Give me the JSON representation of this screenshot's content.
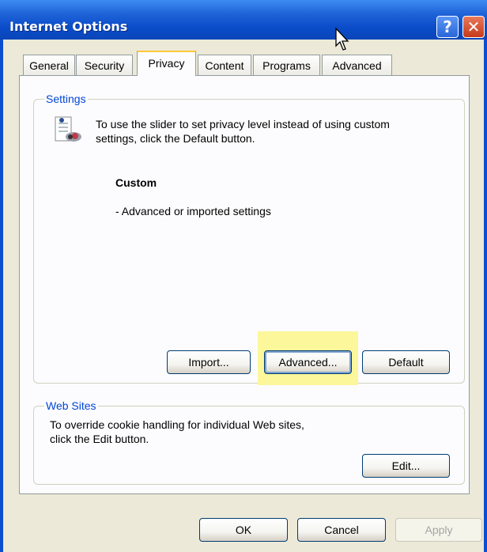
{
  "window": {
    "title": "Internet Options",
    "help_glyph": "?",
    "close_glyph": "✕"
  },
  "tabs": [
    {
      "label": "General"
    },
    {
      "label": "Security"
    },
    {
      "label": "Privacy"
    },
    {
      "label": "Content"
    },
    {
      "label": "Programs"
    },
    {
      "label": "Advanced"
    }
  ],
  "active_tab": "Privacy",
  "settings": {
    "group_label": "Settings",
    "icon": "privacy-icon",
    "info_line1": "To use the slider to set privacy level instead of using custom",
    "info_line2": "settings, click the Default button.",
    "level_title": "Custom",
    "level_desc": "- Advanced or imported settings",
    "buttons": {
      "import": "Import...",
      "advanced": "Advanced...",
      "default": "Default"
    }
  },
  "websites": {
    "group_label": "Web Sites",
    "text_line1": "To override cookie handling for individual Web sites,",
    "text_line2": "click the Edit button.",
    "edit": "Edit..."
  },
  "footer": {
    "ok": "OK",
    "cancel": "Cancel",
    "apply": "Apply"
  },
  "colors": {
    "titlebar": "#0a4cc9",
    "highlight": "#fbf79a",
    "group_label": "#0046d5",
    "active_tab_accent": "#ffc83c"
  }
}
